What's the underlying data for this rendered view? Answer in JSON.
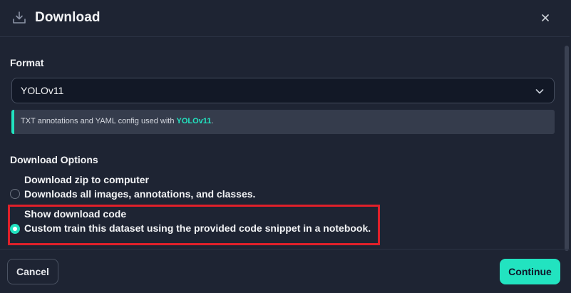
{
  "header": {
    "title": "Download",
    "icon": "download-icon",
    "close_icon": "close-icon"
  },
  "format": {
    "label": "Format",
    "selected": "YOLOv11",
    "info_prefix": "TXT annotations and YAML config used with ",
    "info_highlight": "YOLOv11",
    "info_suffix": "."
  },
  "options": {
    "label": "Download Options",
    "items": [
      {
        "title": "Download zip to computer",
        "description": "Downloads all images, annotations, and classes.",
        "selected": false
      },
      {
        "title": "Show download code",
        "description": "Custom train this dataset using the provided code snippet in a notebook.",
        "selected": true
      }
    ]
  },
  "footer": {
    "cancel_label": "Cancel",
    "continue_label": "Continue"
  },
  "colors": {
    "background": "#1e2433",
    "accent": "#22e3c0",
    "highlight_box": "#e0202a"
  }
}
